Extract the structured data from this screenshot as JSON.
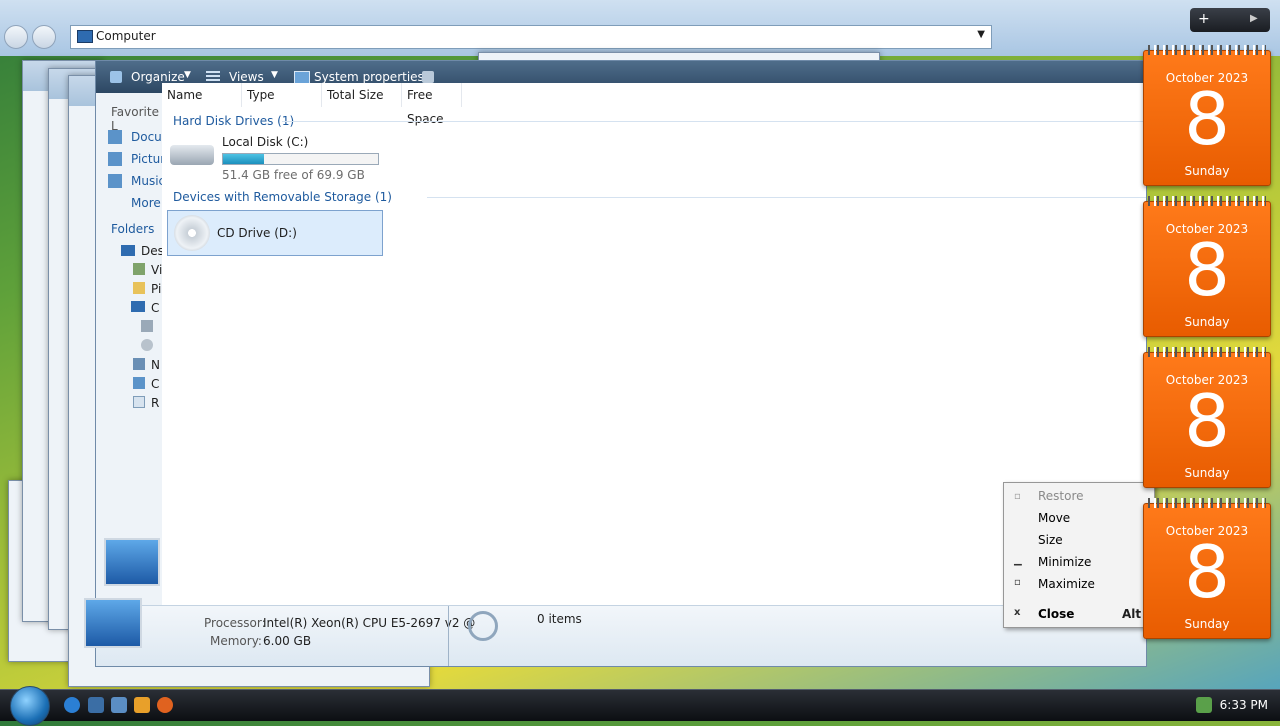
{
  "address": {
    "location": "Computer"
  },
  "toolbar": {
    "organize": "Organize",
    "views": "Views",
    "system_properties": "System properties"
  },
  "nav_pane": {
    "favorite_links": "Favorite L",
    "links": [
      "Docu",
      "Pictur",
      "Music",
      "More"
    ],
    "folders": "Folders",
    "tree": [
      "Des",
      "Vi",
      "Pi",
      "C",
      "",
      "",
      "N",
      "C",
      "R"
    ]
  },
  "columns": [
    "Name",
    "Type",
    "Total Size",
    "Free Space"
  ],
  "groups": {
    "hard_disk": "Hard Disk Drives (1)",
    "removable": "Devices with Removable Storage (1)"
  },
  "drives": {
    "local": {
      "name": "Local Disk (C:)",
      "free": "51.4 GB free of 69.9 GB",
      "used_fraction": 0.265
    },
    "cd": {
      "name": "CD Drive (D:)"
    }
  },
  "details": {
    "processor_label": "Processor:",
    "processor_value": "Intel(R) Xeon(R) CPU E5-2697 v2 @",
    "memory_label": "Memory:",
    "memory_value": "6.00 GB",
    "items": "0 items"
  },
  "context_menu": {
    "restore": "Restore",
    "move": "Move",
    "size": "Size",
    "minimize": "Minimize",
    "maximize": "Maximize",
    "close": "Close",
    "close_shortcut": "Alt"
  },
  "gadget": {
    "month": "October 2023",
    "day": "8",
    "weekday": "Sunday"
  },
  "taskbar": {
    "time": "6:33 PM"
  },
  "colors": {
    "gadget": "#ff6a00",
    "toolbar": "#3a5878",
    "group_text": "#1e5a9e",
    "bar_fill": "#2aa6d2"
  }
}
